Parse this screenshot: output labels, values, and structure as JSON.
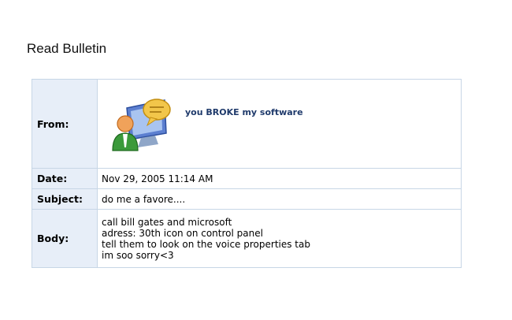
{
  "page": {
    "title": "Read Bulletin"
  },
  "bulletin": {
    "from_label": "From:",
    "from_name": "you BROKE my software",
    "date_label": "Date:",
    "date_value": "Nov 29, 2005 11:14 AM",
    "subject_label": "Subject:",
    "subject_value": "do me a favore....",
    "body_label": "Body:",
    "body_lines": [
      "call bill gates and microsoft",
      "adress: 30th icon on control panel",
      "tell them to look on the voice properties tab",
      "im soo sorry<3"
    ]
  },
  "colors": {
    "label_bg": "#e7eef8",
    "border": "#c7d6e6",
    "from_name": "#1f3a6b"
  }
}
